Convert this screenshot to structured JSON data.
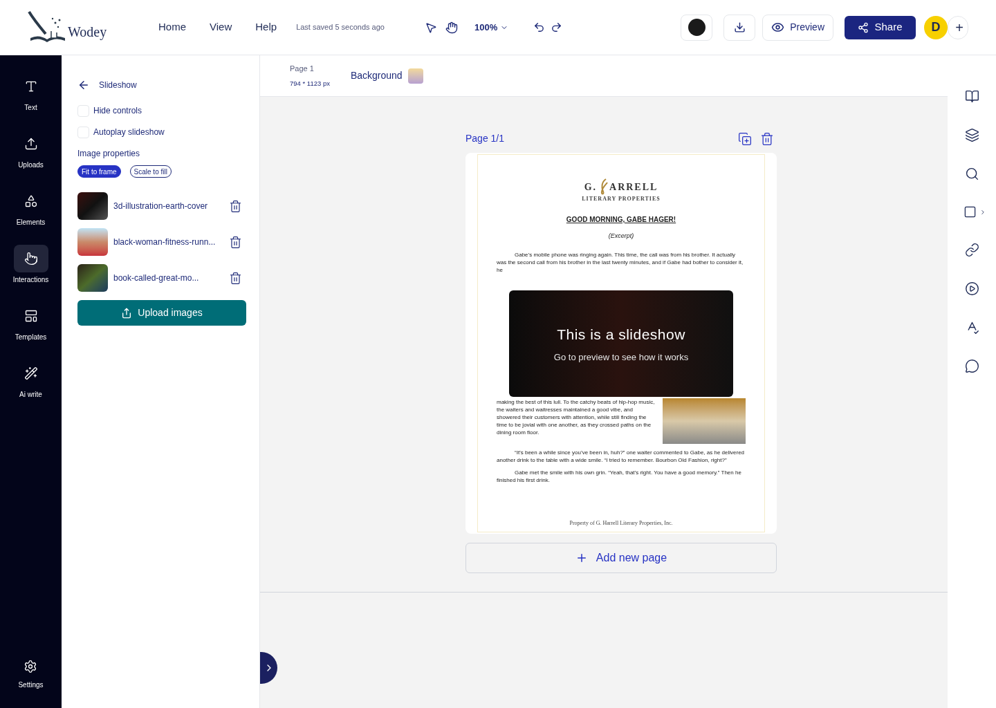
{
  "header": {
    "logo_text": "Wodey",
    "nav": [
      {
        "label": "Home"
      },
      {
        "label": "View"
      },
      {
        "label": "Help"
      }
    ],
    "save_status": "Last saved 5 seconds ago",
    "zoom": "100%",
    "preview_button": "Preview",
    "share_button": "Share",
    "avatar": "D",
    "add_member": "+"
  },
  "rail": {
    "items": [
      {
        "label": "Text",
        "selected": false
      },
      {
        "label": "Uploads",
        "selected": false
      },
      {
        "label": "Elements",
        "selected": false
      },
      {
        "label": "Interactions",
        "selected": true
      },
      {
        "label": "Templates",
        "selected": false
      },
      {
        "label": "Ai write",
        "selected": false
      }
    ],
    "settings": "Settings"
  },
  "panel": {
    "title": "Slideshow",
    "options": [
      {
        "label": "Hide controls",
        "checked": false
      },
      {
        "label": "Autoplay slideshow",
        "checked": false
      }
    ],
    "image_properties": "Image properties",
    "fit_options": [
      {
        "label": "Fit to frame",
        "selected": true
      },
      {
        "label": "Scale to fill",
        "selected": false
      }
    ],
    "images": [
      {
        "name": "3d-illustration-earth-cover"
      },
      {
        "name": "black-woman-fitness-runn..."
      },
      {
        "name": "book-called-great-mo..."
      }
    ],
    "upload_button": "Upload images"
  },
  "canvas_bar": {
    "page_label": "Page 1",
    "page_size": "794 * 1123 px",
    "background_label": "Background"
  },
  "page": {
    "label": "Page 1/1",
    "document": {
      "logo_left": "G.",
      "logo_right": "ARRELL",
      "logo_tagline": "LITERARY PROPERTIES",
      "heading": "GOOD MORNING, GABE HAGER!",
      "subheading": "(Excerpt)",
      "paragraph_1": "Gabe’s mobile phone was ringing again. This time, the call was from his brother. It actually was the second call from his brother in the last twenty minutes, and if Gabe had bother to consider it, he",
      "paragraph_2": "making the best of this lull. To the catchy beats of hip-hop music, the waiters and waitresses maintained a good vibe, and showered their customers with attention, while still finding the time to be jovial with one another, as they crossed paths on the dining room floor.",
      "paragraph_3": "“It’s been a while since you’ve been in, huh?” one waiter commented to Gabe, as he delivered another drink to the table with a wide smile. “I tried to remember. Bourbon Old Fashion, right?”",
      "paragraph_4": "Gabe met the smile with his own grin. “Yeah, that’s right. You have a good memory.” Then he finished his first drink.",
      "footer": "Property of G. Harrell Literary Properties, Inc."
    },
    "slideshow": {
      "title": "This is a slideshow",
      "subtitle": "Go to preview to see how it works"
    },
    "add_page": "Add new page"
  }
}
